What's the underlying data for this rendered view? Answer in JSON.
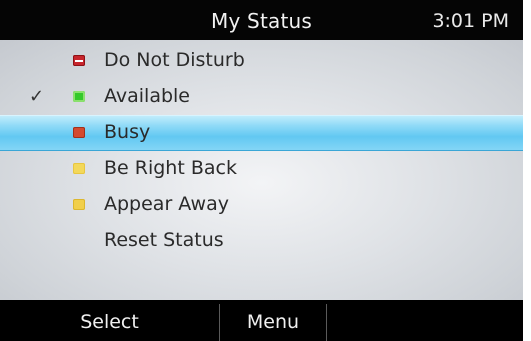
{
  "header": {
    "title": "My Status",
    "time": "3:01 PM"
  },
  "status_list": {
    "items": [
      {
        "label": "Do Not Disturb",
        "icon": "do-not-disturb-icon",
        "color": "#c7252c",
        "checked": false,
        "selected": false
      },
      {
        "label": "Available",
        "icon": "available-icon",
        "color": "#34c92a",
        "checked": true,
        "selected": false
      },
      {
        "label": "Busy",
        "icon": "busy-icon",
        "color": "#d44a2f",
        "checked": false,
        "selected": true
      },
      {
        "label": "Be Right Back",
        "icon": "be-right-back-icon",
        "color": "#f3d85a",
        "checked": false,
        "selected": false
      },
      {
        "label": "Appear Away",
        "icon": "appear-away-icon",
        "color": "#f1cf4b",
        "checked": false,
        "selected": false
      },
      {
        "label": "Reset Status",
        "icon": "",
        "checked": false,
        "selected": false
      }
    ],
    "check_glyph": "✓"
  },
  "softkeys": {
    "select": "Select",
    "menu": "Menu"
  }
}
